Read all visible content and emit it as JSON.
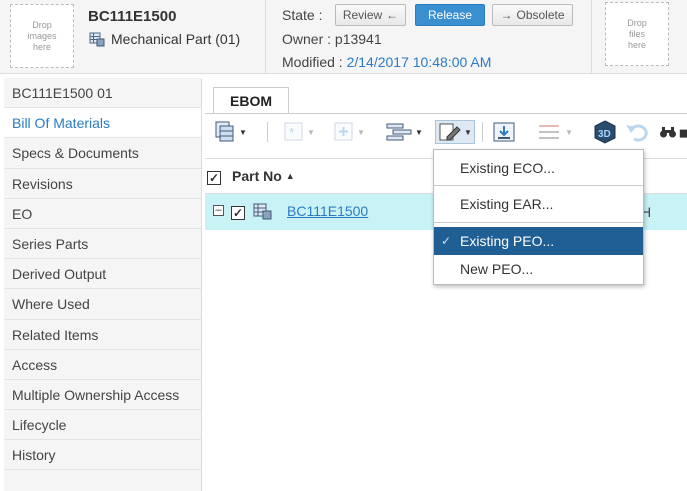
{
  "header": {
    "drop_images": "Drop images here",
    "part_number": "BC111E1500",
    "part_type": "Mechanical Part (01)",
    "state_label": "State :",
    "review_label": "Review",
    "release_label": "Release",
    "obsolete_label": "Obsolete",
    "owner_label": "Owner :",
    "owner_value": "p13941",
    "modified_label": "Modified :",
    "modified_value": "2/14/2017 10:48:00 AM",
    "drop_files": "Drop files here"
  },
  "sidebar": {
    "items": [
      {
        "label": "BC111E1500 01"
      },
      {
        "label": "Bill Of Materials"
      },
      {
        "label": "Specs & Documents"
      },
      {
        "label": "Revisions"
      },
      {
        "label": "EO"
      },
      {
        "label": "Series Parts"
      },
      {
        "label": "Derived Output"
      },
      {
        "label": "Where Used"
      },
      {
        "label": "Related Items"
      },
      {
        "label": "Access"
      },
      {
        "label": "Multiple Ownership Access"
      },
      {
        "label": "Lifecycle"
      },
      {
        "label": "History"
      }
    ]
  },
  "tabs": [
    {
      "label": "EBOM"
    }
  ],
  "grid": {
    "column_part_no": "Part No",
    "rows": [
      {
        "part_no": "BC111E1500",
        "trailing": "H"
      }
    ]
  },
  "menu": {
    "items": [
      {
        "label": "Existing ECO..."
      },
      {
        "label": "Existing EAR..."
      },
      {
        "label": "Existing PEO..."
      },
      {
        "label": "New PEO..."
      }
    ]
  },
  "colors": {
    "accent": "#2b7bc4",
    "release_button": "#3a8fd1",
    "row_highlight": "#c8f2f6",
    "menu_selected": "#1f5f94"
  }
}
